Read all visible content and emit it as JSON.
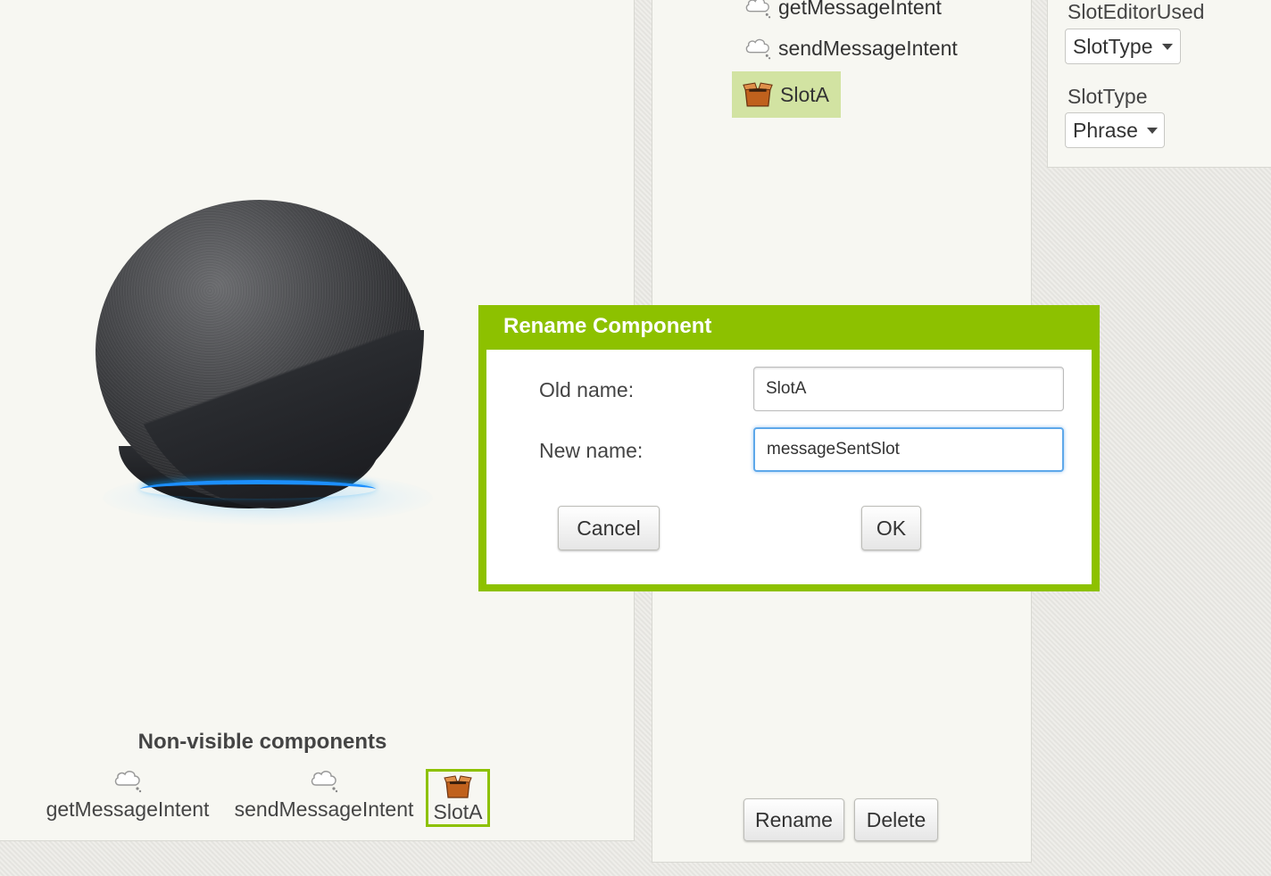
{
  "viewer": {
    "nonvisible_title": "Non-visible components",
    "nonvisible_items": [
      {
        "label": "getMessageIntent",
        "icon": "cloud-icon"
      },
      {
        "label": "sendMessageIntent",
        "icon": "cloud-icon"
      },
      {
        "label": "SlotA",
        "icon": "box-icon",
        "selected": true
      }
    ]
  },
  "tree": {
    "items": [
      {
        "label": "getMessageIntent",
        "icon": "cloud-icon"
      },
      {
        "label": "sendMessageIntent",
        "icon": "cloud-icon"
      },
      {
        "label": "SlotA",
        "icon": "box-icon",
        "selected": true
      }
    ],
    "rename_label": "Rename",
    "delete_label": "Delete"
  },
  "properties": {
    "slot_editor_label": "SlotEditorUsed",
    "slot_editor_value": "SlotType",
    "slot_type_label": "SlotType",
    "slot_type_value": "Phrase"
  },
  "dialog": {
    "title": "Rename Component",
    "old_label": "Old name:",
    "old_value": "SlotA",
    "new_label": "New name:",
    "new_value": "messageSentSlot",
    "cancel_label": "Cancel",
    "ok_label": "OK"
  },
  "colors": {
    "accent": "#8dc100",
    "selection": "#d2e3a2",
    "focus": "#5ea8ea",
    "echo_ring": "#1c8fff"
  }
}
